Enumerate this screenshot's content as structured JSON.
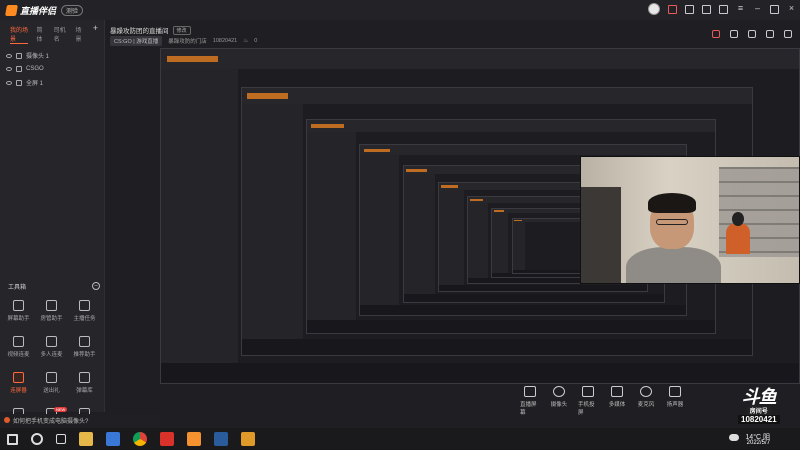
{
  "app": {
    "name": "直播伴侣",
    "version_badge": "测验",
    "colors": {
      "accent": "#ff6a3d",
      "brand": "#ff8a1f",
      "background": "#1f1f23"
    }
  },
  "scene_tabs": [
    "我的场景",
    "简体",
    "司机名",
    "场景"
  ],
  "sources": [
    {
      "label": "摄像头 1",
      "icon": "camera-icon"
    },
    {
      "label": "CSGO",
      "icon": "game-icon"
    },
    {
      "label": "全屏 1",
      "icon": "screen-icon"
    }
  ],
  "toolbox": {
    "title": "工具箱",
    "tools": [
      {
        "label": "屏幕助手",
        "icon": "screen-icon"
      },
      {
        "label": "房管助手",
        "icon": "admin-icon"
      },
      {
        "label": "主播任务",
        "icon": "task-icon"
      },
      {
        "label": "视频连麦",
        "icon": "video-link-icon"
      },
      {
        "label": "多人连麦",
        "icon": "multi-link-icon"
      },
      {
        "label": "推荐助手",
        "icon": "recommend-icon"
      },
      {
        "label": "连屏器",
        "icon": "linker-icon",
        "active": true
      },
      {
        "label": "送出礼",
        "icon": "gift-icon"
      },
      {
        "label": "弹幕库",
        "icon": "danmaku-icon"
      },
      {
        "label": "",
        "icon": "more-icon"
      },
      {
        "label": "",
        "icon": "hot-icon",
        "badge": "NEW"
      },
      {
        "label": "",
        "icon": "upload-icon"
      }
    ]
  },
  "stream": {
    "title": "暴躁攻防团的直播间",
    "edit_label": "修改",
    "category": "CS:GO",
    "category_sub": "游戏直播",
    "room_label": "暴躁攻防的门店",
    "room_id": "10820421",
    "fans": "0"
  },
  "bottom_controls": [
    {
      "label": "直播屏幕",
      "icon": "screen-share-icon"
    },
    {
      "label": "摄像头",
      "icon": "camera-icon"
    },
    {
      "label": "手机投屏",
      "icon": "phone-cast-icon"
    },
    {
      "label": "多媒体",
      "icon": "media-icon"
    },
    {
      "label": "麦克风",
      "icon": "mic-icon"
    },
    {
      "label": "扬声器",
      "icon": "speaker-icon"
    }
  ],
  "watermark": {
    "logo": "斗鱼",
    "sub": "房间号",
    "room_number": "10820421",
    "date": "2022/5/7"
  },
  "tip": "如何把手机变成电脑摄像头?",
  "taskbar": {
    "weather": "14°C 阴",
    "apps": [
      "start-icon",
      "search-icon",
      "taskview-icon",
      "folder-icon",
      "feishu-icon",
      "chrome-icon",
      "wps-icon",
      "livetool-icon",
      "steam-icon",
      "csgo-icon"
    ]
  }
}
